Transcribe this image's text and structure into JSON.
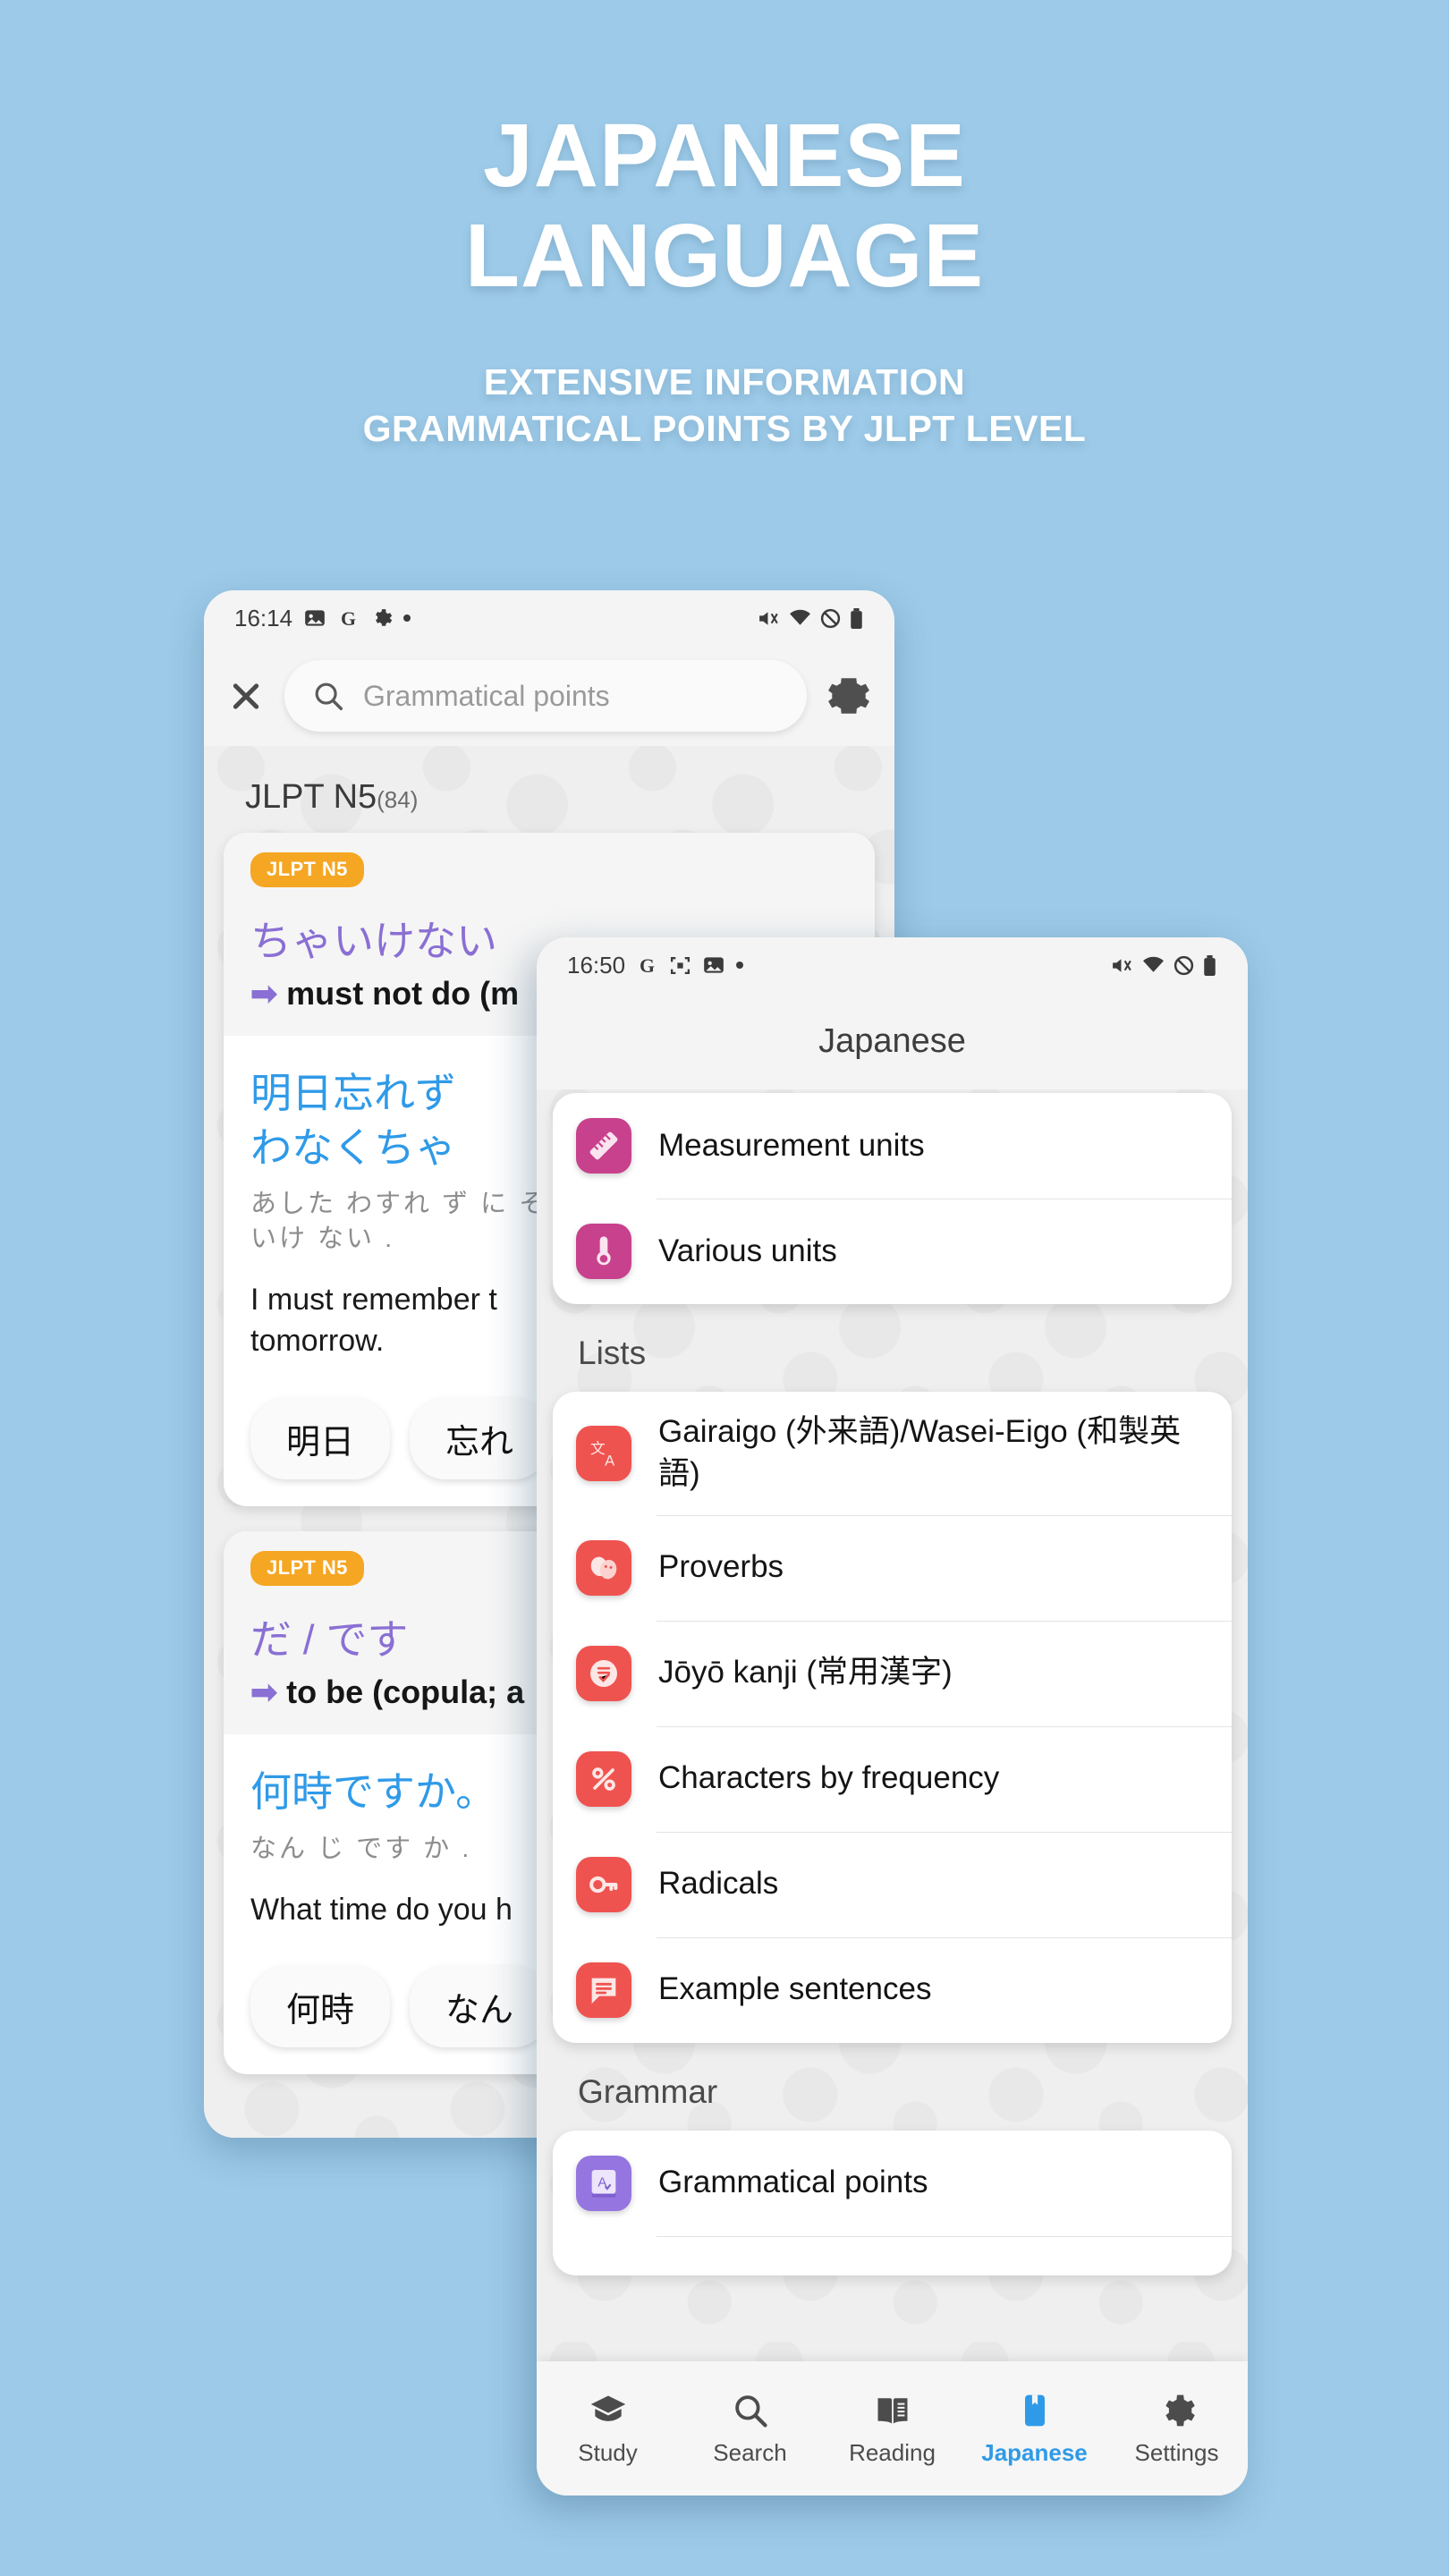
{
  "promo": {
    "title_line1": "JAPANESE",
    "title_line2": "LANGUAGE",
    "subtitle_line1": "EXTENSIVE INFORMATION",
    "subtitle_line2": "GRAMMATICAL POINTS BY JLPT LEVEL"
  },
  "colors": {
    "background": "#9ccae8",
    "accent_blue": "#2f9ae8",
    "purple": "#8a6fd4",
    "badge_orange": "#f5a623",
    "pink_icon": "#c8418c",
    "red_icon": "#ef5350",
    "purple_icon": "#9575e0"
  },
  "phone1": {
    "status": {
      "time": "16:14",
      "icons_left": [
        "photo-icon",
        "google-icon",
        "gear-icon",
        "dot-icon"
      ],
      "icons_right": [
        "mute-icon",
        "wifi-icon",
        "dnd-icon",
        "battery-icon"
      ]
    },
    "appbar": {
      "close_label": "close-icon",
      "search_placeholder": "Grammatical points",
      "settings_label": "gear-icon"
    },
    "section": {
      "title": "JLPT N5",
      "count": "(84)"
    },
    "cards": [
      {
        "badge": "JLPT N5",
        "term": "ちゃいけない",
        "meaning": "must not do (m",
        "sentence_jp": [
          "明日忘れず",
          "わなくちゃ"
        ],
        "furigana": [
          "あした わすれ ず に そ",
          "いけ ない ."
        ],
        "sentence_en": [
          "I must remember t",
          "tomorrow."
        ],
        "chips": [
          "明日",
          "忘れ"
        ]
      },
      {
        "badge": "JLPT N5",
        "term": "だ / です",
        "meaning": "to be (copula; a",
        "sentence_jp": [
          "何時ですか。"
        ],
        "furigana": [
          "なん じ です か ."
        ],
        "sentence_en": [
          "What time do you h"
        ],
        "chips": [
          "何時",
          "なん"
        ]
      }
    ]
  },
  "phone2": {
    "status": {
      "time": "16:50",
      "icons_left": [
        "google-icon",
        "scan-icon",
        "photo-icon",
        "dot-icon"
      ],
      "icons_right": [
        "mute-icon",
        "wifi-icon",
        "dnd-icon",
        "battery-icon"
      ]
    },
    "appbar": {
      "title": "Japanese"
    },
    "units_card": [
      {
        "label": "Measurement units",
        "icon": "ruler-icon",
        "color": "#c8418c"
      },
      {
        "label": "Various units",
        "icon": "thermometer-icon",
        "color": "#c8418c"
      }
    ],
    "lists_header": "Lists",
    "lists_card": [
      {
        "label": "Gairaigo (外来語)/Wasei-Eigo (和製英語)",
        "icon": "translate-icon",
        "color": "#ef5350"
      },
      {
        "label": "Proverbs",
        "icon": "masks-icon",
        "color": "#ef5350"
      },
      {
        "label": "Jōyō kanji (常用漢字)",
        "icon": "document-check-icon",
        "color": "#ef5350"
      },
      {
        "label": "Characters by frequency",
        "icon": "percent-icon",
        "color": "#ef5350"
      },
      {
        "label": "Radicals",
        "icon": "key-icon",
        "color": "#ef5350"
      },
      {
        "label": "Example sentences",
        "icon": "chat-lines-icon",
        "color": "#ef5350"
      }
    ],
    "grammar_header": "Grammar",
    "grammar_card": [
      {
        "label": "Grammatical points",
        "icon": "book-a-icon",
        "color": "#9575e0"
      }
    ],
    "bottom_nav": [
      {
        "label": "Study",
        "icon": "graduation-cap-icon",
        "active": false
      },
      {
        "label": "Search",
        "icon": "search-icon",
        "active": false
      },
      {
        "label": "Reading",
        "icon": "open-book-icon",
        "active": false
      },
      {
        "label": "Japanese",
        "icon": "bookmark-icon",
        "active": true
      },
      {
        "label": "Settings",
        "icon": "gear-icon",
        "active": false
      }
    ]
  }
}
